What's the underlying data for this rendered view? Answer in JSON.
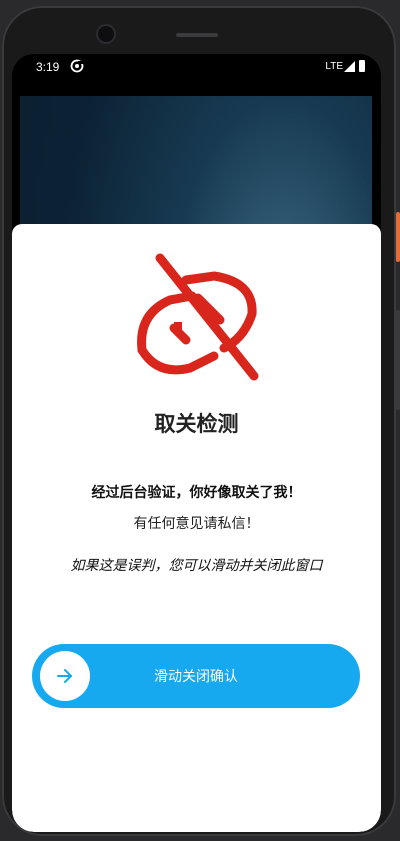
{
  "status_bar": {
    "time": "3:19",
    "network": "LTE",
    "sync_icon": "sync-icon",
    "signal_icon": "signal-icon",
    "battery_icon": "battery-icon"
  },
  "dialog": {
    "logo_icon": "unlink-plug-icon",
    "logo_color": "#d9261c",
    "title": "取关检测",
    "message_bold": "经过后台验证，你好像取关了我！",
    "message": "有任何意见请私信！",
    "hint": "如果这是误判，您可以滑动并关闭此窗口"
  },
  "slider": {
    "label": "滑动关闭确认",
    "arrow_icon": "arrow-right-icon",
    "color": "#17a9ef"
  }
}
